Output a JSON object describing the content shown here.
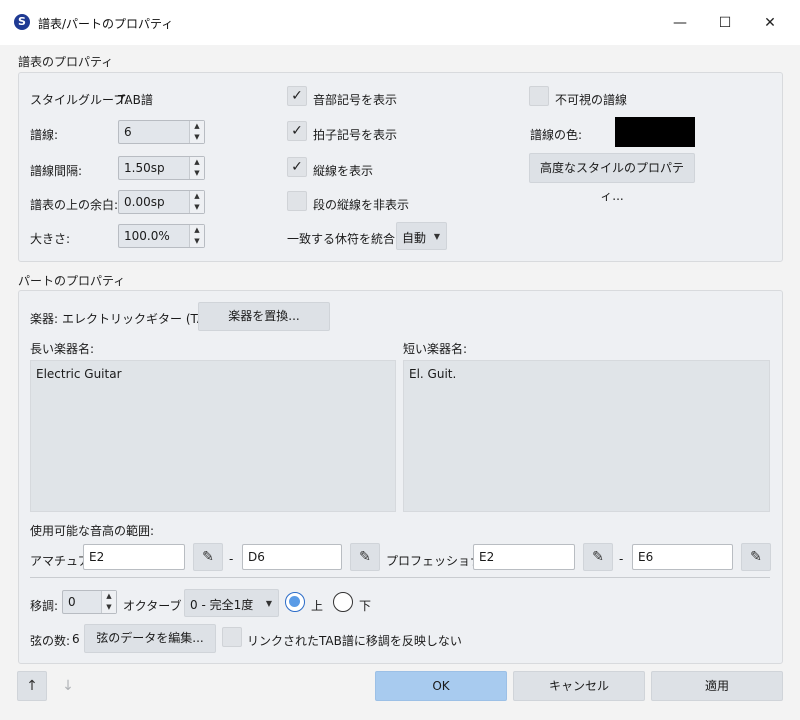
{
  "window": {
    "title": "譜表/パートのプロパティ",
    "icon_letter": "S",
    "minimize": "—",
    "maximize": "☐",
    "close": "✕"
  },
  "staff": {
    "section_title": "譜表のプロパティ",
    "style_group_label": "スタイルグループ:",
    "style_group_value": "TAB譜",
    "lines_label": "譜線:",
    "lines_value": "6",
    "line_spacing_label": "譜線間隔:",
    "line_spacing_value": "1.50sp",
    "extra_space_label": "譜表の上の余白:",
    "extra_space_value": "0.00sp",
    "scale_label": "大きさ:",
    "scale_value": "100.0%",
    "show_clef_label": "音部記号を表示",
    "show_clef_checked": true,
    "show_timesig_label": "拍子記号を表示",
    "show_timesig_checked": true,
    "show_barlines_label": "縦線を表示",
    "show_barlines_checked": true,
    "hide_system_barline_label": "段の縦線を非表示",
    "hide_system_barline_checked": false,
    "merge_rests_label": "一致する休符を統合:",
    "merge_rests_value": "自動",
    "invisible_lines_label": "不可視の譜線",
    "invisible_lines_checked": false,
    "line_color_label": "譜線の色:",
    "line_color_value": "#000000",
    "advanced_button": "高度なスタイルのプロパティ..."
  },
  "part": {
    "section_title": "パートのプロパティ",
    "instrument_label": "楽器:",
    "instrument_value": "エレクトリックギター (TAB譜)",
    "replace_button": "楽器を置換...",
    "long_name_label": "長い楽器名:",
    "long_name_value": "Electric Guitar",
    "short_name_label": "短い楽器名:",
    "short_name_value": "El. Guit.",
    "range_label": "使用可能な音高の範囲:",
    "amateur_label": "アマチュア:",
    "amateur_low": "E2",
    "amateur_high": "D6",
    "pro_label": "プロフェッショナル:",
    "pro_low": "E2",
    "pro_high": "E6",
    "dash": "-",
    "transpose_label": "移調:",
    "transpose_octave_value": "0",
    "octave_label": "オクターブ +",
    "interval_value": "0 - 完全1度",
    "up_label": "上",
    "down_label": "下",
    "strings_label": "弦の数:",
    "strings_value": "6",
    "edit_strings_button": "弦のデータを編集...",
    "no_linked_transpose_label": "リンクされたTAB譜に移調を反映しない",
    "no_linked_transpose_checked": false
  },
  "footer": {
    "up_arrow": "↑",
    "down_arrow": "↓",
    "ok": "OK",
    "cancel": "キャンセル",
    "apply": "適用"
  },
  "colors": {
    "ok_button": "#a8cbef",
    "panel_bg": "#eef0f3",
    "checkbox_bg": "#e0e3e7"
  }
}
